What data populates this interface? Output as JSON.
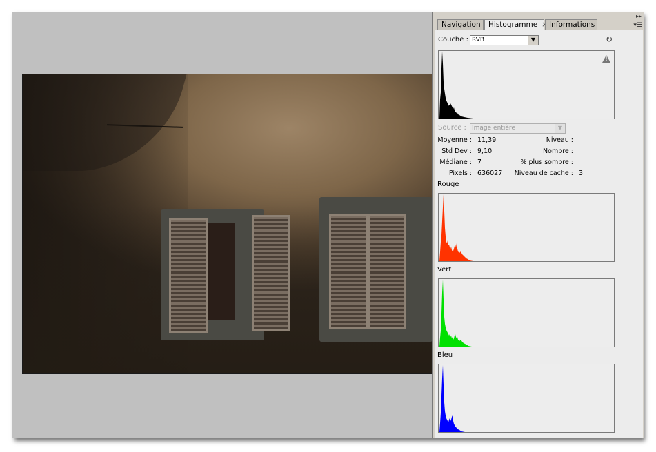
{
  "panel": {
    "tabs": [
      {
        "label": "Navigation"
      },
      {
        "label": "Histogramme",
        "close": "×"
      },
      {
        "label": "Informations"
      }
    ],
    "channel_label": "Couche :",
    "channel_value": "RVB",
    "source_label": "Source :",
    "source_value": "Image entière",
    "stats_left": [
      {
        "label": "Moyenne :",
        "value": "11,39"
      },
      {
        "label": "Std Dev :",
        "value": "9,10"
      },
      {
        "label": "Médiane :",
        "value": "7"
      },
      {
        "label": "Pixels :",
        "value": "636027"
      }
    ],
    "stats_right": [
      {
        "label": "Niveau :",
        "value": ""
      },
      {
        "label": "Nombre :",
        "value": ""
      },
      {
        "label": "% plus sombre :",
        "value": ""
      },
      {
        "label": "Niveau de cache :",
        "value": "3"
      }
    ],
    "channels": [
      {
        "label": "Rouge",
        "color": "#ff3300"
      },
      {
        "label": "Vert",
        "color": "#00e000"
      },
      {
        "label": "Bleu",
        "color": "#0000ff"
      }
    ],
    "main_color": "#000000",
    "icons": {
      "refresh": "refresh-icon",
      "warning": "warning-icon",
      "panel_menu": "panel-menu-icon",
      "collapse": "collapse-icon"
    }
  }
}
